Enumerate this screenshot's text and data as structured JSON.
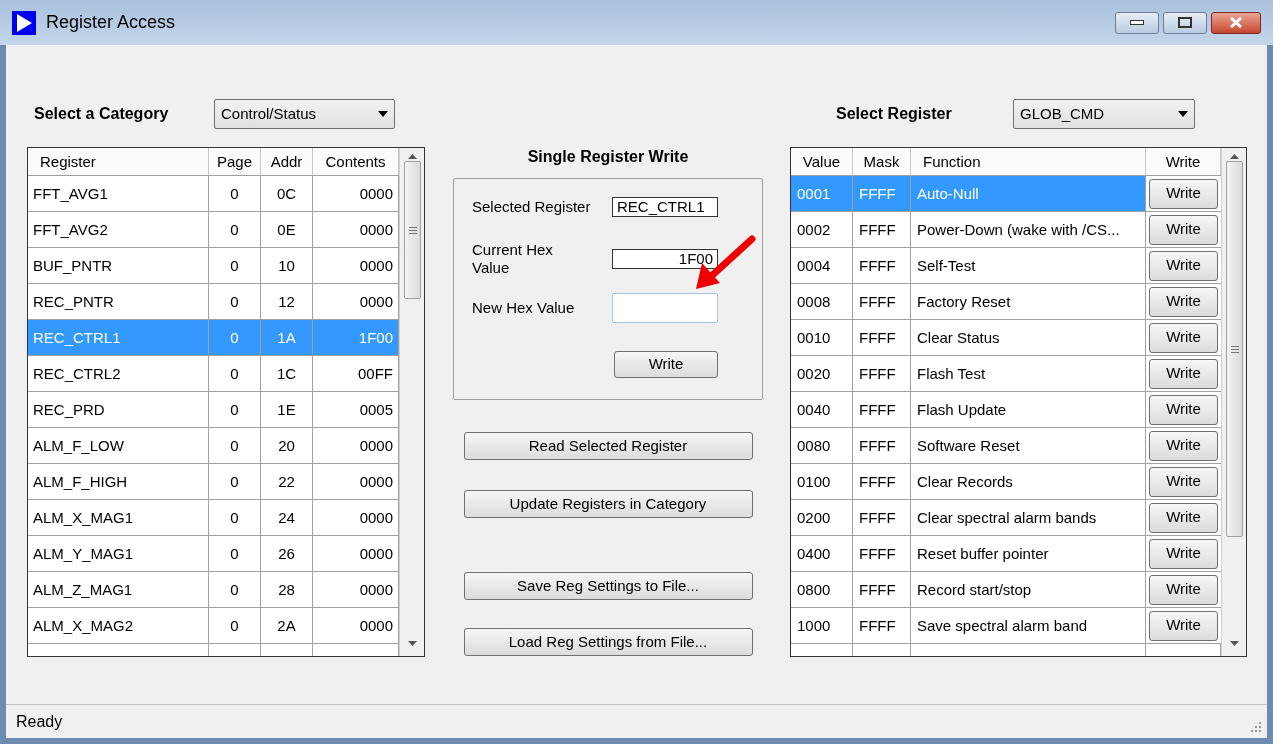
{
  "window": {
    "title": "Register Access"
  },
  "category": {
    "label": "Select a Category",
    "value": "Control/Status"
  },
  "registers": {
    "columns": [
      "Register",
      "Page",
      "Addr",
      "Contents"
    ],
    "rows": [
      {
        "cells": [
          "FFT_AVG1",
          "0",
          "0C",
          "0000"
        ],
        "selected": false
      },
      {
        "cells": [
          "FFT_AVG2",
          "0",
          "0E",
          "0000"
        ],
        "selected": false
      },
      {
        "cells": [
          "BUF_PNTR",
          "0",
          "10",
          "0000"
        ],
        "selected": false
      },
      {
        "cells": [
          "REC_PNTR",
          "0",
          "12",
          "0000"
        ],
        "selected": false
      },
      {
        "cells": [
          "REC_CTRL1",
          "0",
          "1A",
          "1F00"
        ],
        "selected": true
      },
      {
        "cells": [
          "REC_CTRL2",
          "0",
          "1C",
          "00FF"
        ],
        "selected": false
      },
      {
        "cells": [
          "REC_PRD",
          "0",
          "1E",
          "0005"
        ],
        "selected": false
      },
      {
        "cells": [
          "ALM_F_LOW",
          "0",
          "20",
          "0000"
        ],
        "selected": false
      },
      {
        "cells": [
          "ALM_F_HIGH",
          "0",
          "22",
          "0000"
        ],
        "selected": false
      },
      {
        "cells": [
          "ALM_X_MAG1",
          "0",
          "24",
          "0000"
        ],
        "selected": false
      },
      {
        "cells": [
          "ALM_Y_MAG1",
          "0",
          "26",
          "0000"
        ],
        "selected": false
      },
      {
        "cells": [
          "ALM_Z_MAG1",
          "0",
          "28",
          "0000"
        ],
        "selected": false
      },
      {
        "cells": [
          "ALM_X_MAG2",
          "0",
          "2A",
          "0000"
        ],
        "selected": false
      }
    ]
  },
  "single_write": {
    "title": "Single Register Write",
    "selected_register_label": "Selected Register",
    "selected_register": "REC_CTRL1",
    "current_label": "Current Hex Value",
    "current_value": "1F00",
    "new_label": "New Hex Value",
    "button": "Write"
  },
  "actions": [
    "Read Selected Register",
    "Update Registers in Category",
    "Save Reg Settings to File...",
    "Load Reg Settings from File..."
  ],
  "register_select": {
    "label": "Select Register",
    "value": "GLOB_CMD"
  },
  "functions": {
    "columns": [
      "Value",
      "Mask",
      "Function",
      "Write"
    ],
    "rows": [
      {
        "value": "0001",
        "mask": "FFFF",
        "function": "Auto-Null",
        "button": "Write",
        "selected": true
      },
      {
        "value": "0002",
        "mask": "FFFF",
        "function": "Power-Down (wake with /CS...",
        "button": "Write",
        "selected": false
      },
      {
        "value": "0004",
        "mask": "FFFF",
        "function": "Self-Test",
        "button": "Write",
        "selected": false
      },
      {
        "value": "0008",
        "mask": "FFFF",
        "function": "Factory Reset",
        "button": "Write",
        "selected": false
      },
      {
        "value": "0010",
        "mask": "FFFF",
        "function": "Clear Status",
        "button": "Write",
        "selected": false
      },
      {
        "value": "0020",
        "mask": "FFFF",
        "function": "Flash Test",
        "button": "Write",
        "selected": false
      },
      {
        "value": "0040",
        "mask": "FFFF",
        "function": "Flash Update",
        "button": "Write",
        "selected": false
      },
      {
        "value": "0080",
        "mask": "FFFF",
        "function": "Software Reset",
        "button": "Write",
        "selected": false
      },
      {
        "value": "0100",
        "mask": "FFFF",
        "function": "Clear Records",
        "button": "Write",
        "selected": false
      },
      {
        "value": "0200",
        "mask": "FFFF",
        "function": "Clear spectral alarm bands",
        "button": "Write",
        "selected": false
      },
      {
        "value": "0400",
        "mask": "FFFF",
        "function": "Reset buffer pointer",
        "button": "Write",
        "selected": false
      },
      {
        "value": "0800",
        "mask": "FFFF",
        "function": "Record start/stop",
        "button": "Write",
        "selected": false
      },
      {
        "value": "1000",
        "mask": "FFFF",
        "function": "Save spectral alarm band",
        "button": "Write",
        "selected": false
      }
    ]
  },
  "status_bar": "Ready"
}
